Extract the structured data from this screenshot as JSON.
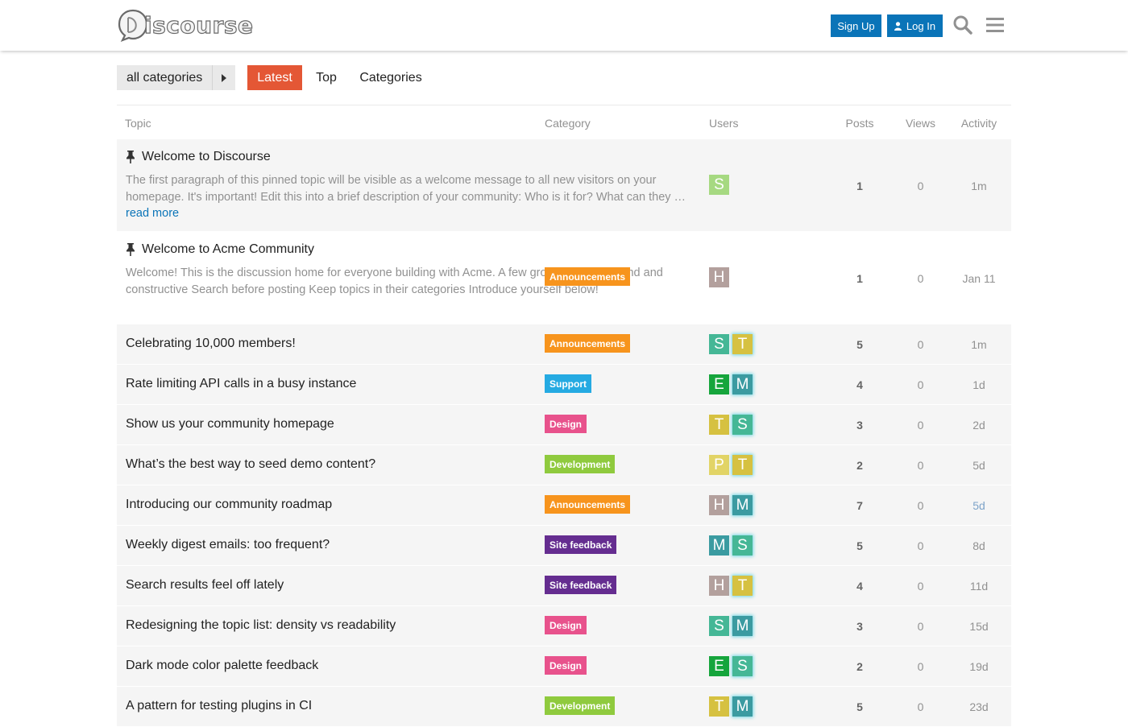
{
  "header": {
    "logo_text": "iscourse",
    "signup_label": "Sign Up",
    "login_label": "Log In"
  },
  "nav": {
    "category_dropdown": "all categories",
    "tabs": [
      "Latest",
      "Top",
      "Categories"
    ],
    "active_tab": "Latest"
  },
  "table": {
    "columns": [
      "Topic",
      "Category",
      "Users",
      "Posts",
      "Views",
      "Activity"
    ]
  },
  "topics": [
    {
      "title": "Welcome to Discourse",
      "pinned": true,
      "excerpt": "The first paragraph of this pinned topic will be visible as a welcome message to all new visitors on your homepage. It's important! Edit this into a brief description of your community: Who is it for? What can they",
      "excerpt_more": "… ",
      "read_more": "read more",
      "category": null,
      "users": [
        {
          "letter": "S",
          "color": "#a6d981",
          "poster": false
        }
      ],
      "posts": "1",
      "views": "0",
      "activity": "1m"
    },
    {
      "title": "Welcome to Acme Community",
      "pinned": true,
      "excerpt": "Welcome! This is the discussion home for everyone building with Acme. A few ground rules: Be kind and constructive Search before posting Keep topics in their categories Introduce yourself below!",
      "category": {
        "name": "Announcements",
        "color": "#f7941d"
      },
      "users": [
        {
          "letter": "H",
          "color": "#b3a09d",
          "poster": false
        }
      ],
      "posts": "1",
      "views": "0",
      "activity": "Jan 11"
    },
    {
      "title": "Celebrating 10,000 members!",
      "category": {
        "name": "Announcements",
        "color": "#f7941d"
      },
      "users": [
        {
          "letter": "S",
          "color": "#45b796",
          "poster": false
        },
        {
          "letter": "T",
          "color": "#d6c141",
          "poster": true
        }
      ],
      "posts": "5",
      "views": "0",
      "activity": "1m"
    },
    {
      "title": "Rate limiting API calls in a busy instance",
      "category": {
        "name": "Support",
        "color": "#25aae2"
      },
      "users": [
        {
          "letter": "E",
          "color": "#16a53c",
          "poster": false
        },
        {
          "letter": "M",
          "color": "#3b9ba1",
          "poster": true
        }
      ],
      "posts": "4",
      "views": "0",
      "activity": "1d"
    },
    {
      "title": "Show us your community homepage",
      "category": {
        "name": "Design",
        "color": "#e8528c"
      },
      "users": [
        {
          "letter": "T",
          "color": "#d6c141",
          "poster": false
        },
        {
          "letter": "S",
          "color": "#45b796",
          "poster": true
        }
      ],
      "posts": "3",
      "views": "0",
      "activity": "2d"
    },
    {
      "title": "What’s the best way to seed demo content?",
      "category": {
        "name": "Development",
        "color": "#8fca3e"
      },
      "users": [
        {
          "letter": "P",
          "color": "#e2d466",
          "poster": false
        },
        {
          "letter": "T",
          "color": "#d6c141",
          "poster": true
        }
      ],
      "posts": "2",
      "views": "0",
      "activity": "5d"
    },
    {
      "title": "Introducing our community roadmap",
      "category": {
        "name": "Announcements",
        "color": "#f7941d"
      },
      "users": [
        {
          "letter": "H",
          "color": "#b3a09d",
          "poster": false
        },
        {
          "letter": "M",
          "color": "#3b9ba1",
          "poster": true
        }
      ],
      "posts": "7",
      "views": "0",
      "activity": "5d",
      "activity_fresh": true
    },
    {
      "title": "Weekly digest emails: too frequent?",
      "category": {
        "name": "Site feedback",
        "color": "#652d90"
      },
      "users": [
        {
          "letter": "M",
          "color": "#3b9ba1",
          "poster": false
        },
        {
          "letter": "S",
          "color": "#45b796",
          "poster": true
        }
      ],
      "posts": "5",
      "views": "0",
      "activity": "8d"
    },
    {
      "title": "Search results feel off lately",
      "category": {
        "name": "Site feedback",
        "color": "#652d90"
      },
      "users": [
        {
          "letter": "H",
          "color": "#b3a09d",
          "poster": false
        },
        {
          "letter": "T",
          "color": "#d6c141",
          "poster": true
        }
      ],
      "posts": "4",
      "views": "0",
      "activity": "11d"
    },
    {
      "title": "Redesigning the topic list: density vs readability",
      "category": {
        "name": "Design",
        "color": "#e8528c"
      },
      "users": [
        {
          "letter": "S",
          "color": "#45b796",
          "poster": false
        },
        {
          "letter": "M",
          "color": "#3b9ba1",
          "poster": true
        }
      ],
      "posts": "3",
      "views": "0",
      "activity": "15d"
    },
    {
      "title": "Dark mode color palette feedback",
      "category": {
        "name": "Design",
        "color": "#e8528c"
      },
      "users": [
        {
          "letter": "E",
          "color": "#16a53c",
          "poster": false
        },
        {
          "letter": "S",
          "color": "#45b796",
          "poster": true
        }
      ],
      "posts": "2",
      "views": "0",
      "activity": "19d"
    },
    {
      "title": "A pattern for testing plugins in CI",
      "category": {
        "name": "Development",
        "color": "#8fca3e"
      },
      "users": [
        {
          "letter": "T",
          "color": "#d6c141",
          "poster": false
        },
        {
          "letter": "M",
          "color": "#3b9ba1",
          "poster": true
        }
      ],
      "posts": "5",
      "views": "0",
      "activity": "23d"
    }
  ]
}
